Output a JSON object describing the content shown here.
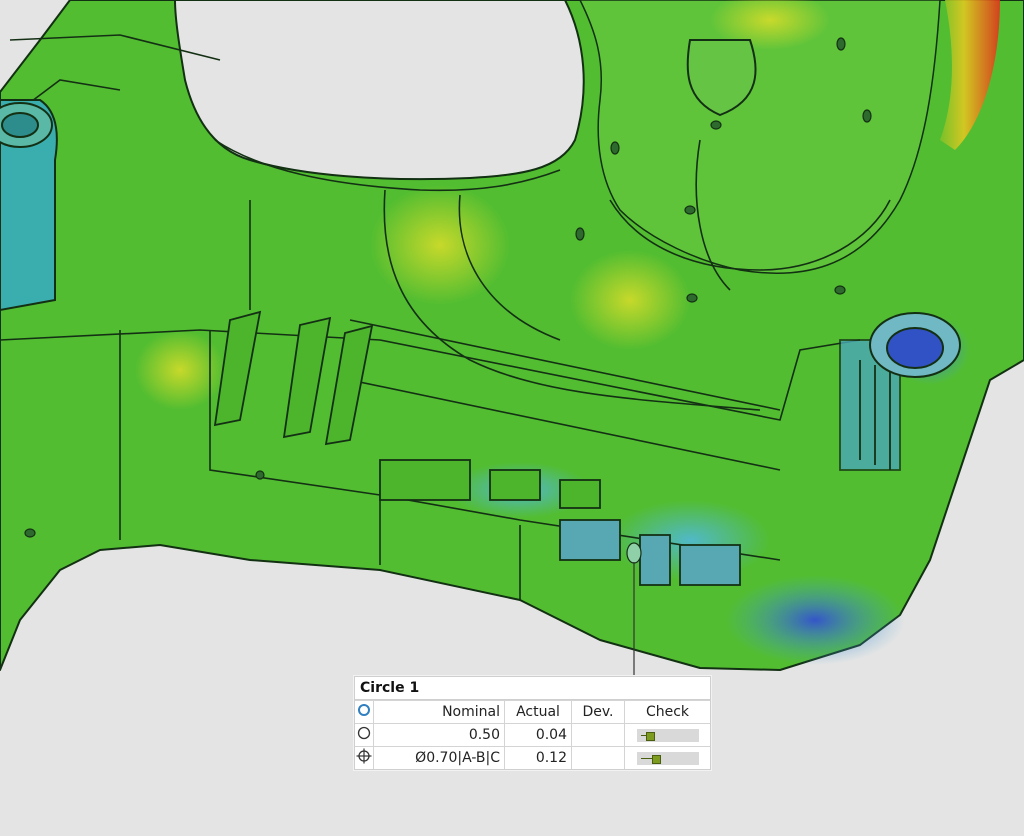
{
  "callout": {
    "title": "Circle 1",
    "headers": {
      "nominal": "Nominal",
      "actual": "Actual",
      "dev": "Dev.",
      "check": "Check"
    },
    "rows": [
      {
        "icon": "circle-outline-icon",
        "nominal": "0.50",
        "actual": "0.04",
        "dev": "",
        "check_fraction": 0.08
      },
      {
        "icon": "position-crosshair-icon",
        "nominal": "Ø0.70|A-B|C",
        "actual": "0.12",
        "dev": "",
        "check_fraction": 0.17
      }
    ]
  },
  "colors": {
    "background": "#e4e4e4",
    "surface_green": "#4fbf2c",
    "deviation_yellow": "#d9d92a",
    "deviation_blue": "#3a66d8",
    "deviation_red": "#e0341c",
    "check_bar": "#7d9c1f",
    "header_icon": "#2f7fc1"
  }
}
